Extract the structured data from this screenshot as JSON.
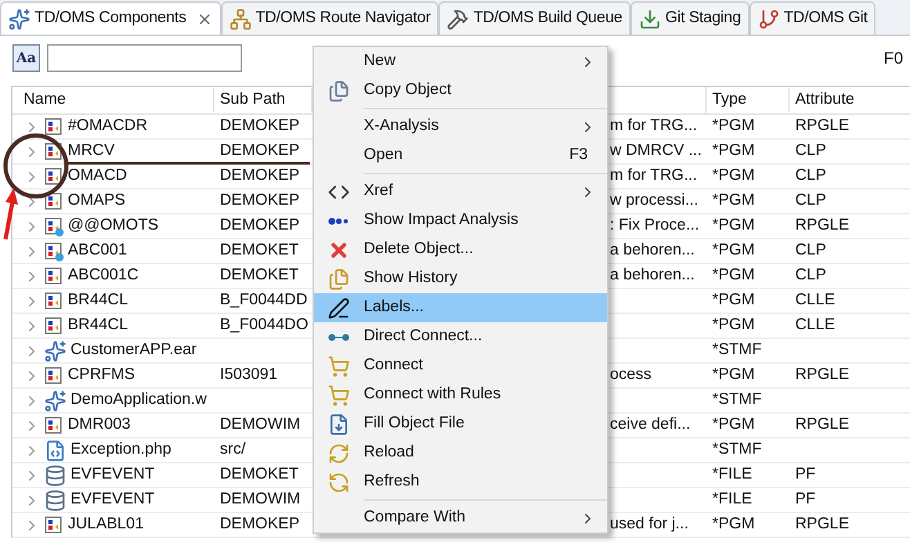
{
  "tabs": [
    {
      "label": "TD/OMS Components",
      "selected": true,
      "closable": true
    },
    {
      "label": "TD/OMS Route Navigator",
      "selected": false
    },
    {
      "label": "TD/OMS Build Queue",
      "selected": false
    },
    {
      "label": "Git Staging",
      "selected": false
    },
    {
      "label": "TD/OMS Git",
      "selected": false
    }
  ],
  "toolbar": {
    "font_button": "Aa",
    "right_text": "F0"
  },
  "table": {
    "columns": [
      "Name",
      "Sub Path",
      "Type",
      "Attribute"
    ],
    "rows": [
      {
        "kind": "pgm",
        "name": "#OMACDR",
        "sub_path": "DEMOKEP",
        "column_3": "m for TRG...",
        "type": "*PGM",
        "attribute": "RPGLE"
      },
      {
        "kind": "pgm",
        "name": "MRCV",
        "sub_path": "DEMOKEP",
        "column_3": "w DMRCV ...",
        "type": "*PGM",
        "attribute": "CLP"
      },
      {
        "kind": "pgm",
        "name": "OMACD",
        "sub_path": "DEMOKEP",
        "column_3": "m for TRG...",
        "type": "*PGM",
        "attribute": "CLP"
      },
      {
        "kind": "pgm",
        "name": "OMAPS",
        "sub_path": "DEMOKEP",
        "column_3": "w processi...",
        "type": "*PGM",
        "attribute": "CLP"
      },
      {
        "kind": "pgm-labeled",
        "name": "@@OMOTS",
        "sub_path": "DEMOKEP",
        "column_3": ": Fix Proce...",
        "type": "*PGM",
        "attribute": "RPGLE"
      },
      {
        "kind": "pgm-labeled",
        "name": "ABC001",
        "sub_path": "DEMOKET",
        "column_3": "a behoren...",
        "type": "*PGM",
        "attribute": "CLP"
      },
      {
        "kind": "pgm",
        "name": "ABC001C",
        "sub_path": "DEMOKET",
        "column_3": "a behoren...",
        "type": "*PGM",
        "attribute": "CLP"
      },
      {
        "kind": "pgm",
        "name": "BR44CL",
        "sub_path": "B_F0044DD",
        "type": "*PGM",
        "attribute": "CLLE"
      },
      {
        "kind": "pgm",
        "name": "BR44CL",
        "sub_path": "B_F0044DO",
        "type": "*PGM",
        "attribute": "CLLE"
      },
      {
        "kind": "app",
        "name": "CustomerAPP.ear",
        "type": "*STMF"
      },
      {
        "kind": "pgm",
        "name": "CPRFMS",
        "sub_path": "I503091",
        "column_3": "ocess",
        "type": "*PGM",
        "attribute": "RPGLE"
      },
      {
        "kind": "app",
        "name": "DemoApplication.w",
        "type": "*STMF"
      },
      {
        "kind": "pgm",
        "name": "DMR003",
        "sub_path": "DEMOWIM",
        "column_3": "ceive defi...",
        "type": "*PGM",
        "attribute": "RPGLE"
      },
      {
        "kind": "php",
        "name": "Exception.php",
        "sub_path": "src/",
        "type": "*STMF"
      },
      {
        "kind": "file",
        "name": "EVFEVENT",
        "sub_path": "DEMOKET",
        "type": "*FILE",
        "attribute": "PF"
      },
      {
        "kind": "file",
        "name": "EVFEVENT",
        "sub_path": "DEMOWIM",
        "type": "*FILE",
        "attribute": "PF"
      },
      {
        "kind": "pgm",
        "name": "JULABL01",
        "sub_path": "DEMOKEP",
        "column_3": "used for j...",
        "type": "*PGM",
        "attribute": "RPGLE"
      }
    ]
  },
  "context_menu": [
    {
      "kind": "item",
      "label": "New",
      "submenu": true,
      "selected": false
    },
    {
      "kind": "item",
      "label": "Copy Object",
      "selected": false
    },
    {
      "kind": "separator"
    },
    {
      "kind": "item",
      "label": "X-Analysis",
      "submenu": true,
      "selected": false
    },
    {
      "kind": "item",
      "label": "Open",
      "shortcut": "F3",
      "selected": false
    },
    {
      "kind": "separator"
    },
    {
      "kind": "item",
      "label": "Xref",
      "submenu": true,
      "selected": false
    },
    {
      "kind": "item",
      "label": "Show Impact Analysis",
      "selected": false
    },
    {
      "kind": "item",
      "label": "Delete Object...",
      "selected": false
    },
    {
      "kind": "item",
      "label": "Show History",
      "selected": false
    },
    {
      "kind": "item",
      "label": "Labels...",
      "selected": true
    },
    {
      "kind": "item",
      "label": "Direct Connect...",
      "selected": false
    },
    {
      "kind": "item",
      "label": "Connect",
      "selected": false
    },
    {
      "kind": "item",
      "label": "Connect with Rules",
      "selected": false
    },
    {
      "kind": "item",
      "label": "Fill Object File",
      "selected": false
    },
    {
      "kind": "item",
      "label": "Reload",
      "selected": false
    },
    {
      "kind": "item",
      "label": "Refresh",
      "selected": false
    },
    {
      "kind": "separator"
    },
    {
      "kind": "item",
      "label": "Compare With",
      "submenu": true,
      "selected": false
    }
  ]
}
